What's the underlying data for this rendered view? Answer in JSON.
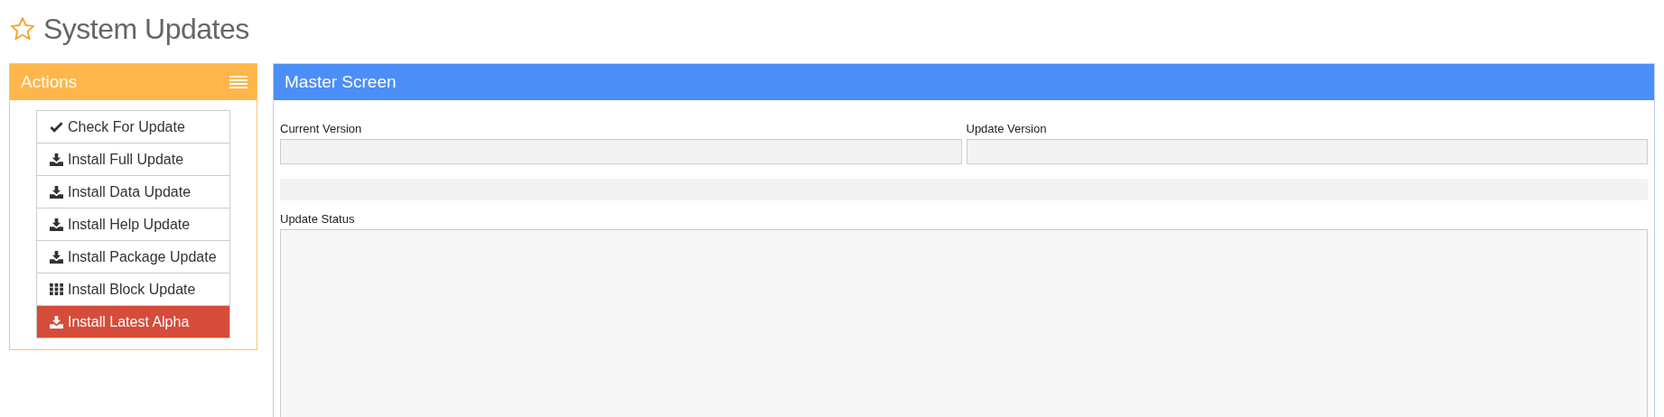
{
  "page_title": "System Updates",
  "actions": {
    "title": "Actions",
    "buttons": [
      {
        "label": "Check For Update",
        "kind": "check",
        "selected": false
      },
      {
        "label": "Install Full Update",
        "kind": "download",
        "selected": false
      },
      {
        "label": "Install Data Update",
        "kind": "download",
        "selected": false
      },
      {
        "label": "Install Help Update",
        "kind": "download",
        "selected": false
      },
      {
        "label": "Install Package Update",
        "kind": "download",
        "selected": false
      },
      {
        "label": "Install Block Update",
        "kind": "grid",
        "selected": false
      },
      {
        "label": "Install Latest Alpha",
        "kind": "download",
        "selected": true
      }
    ]
  },
  "master": {
    "title": "Master Screen",
    "current_version_label": "Current Version",
    "update_version_label": "Update Version",
    "update_status_label": "Update Status"
  }
}
